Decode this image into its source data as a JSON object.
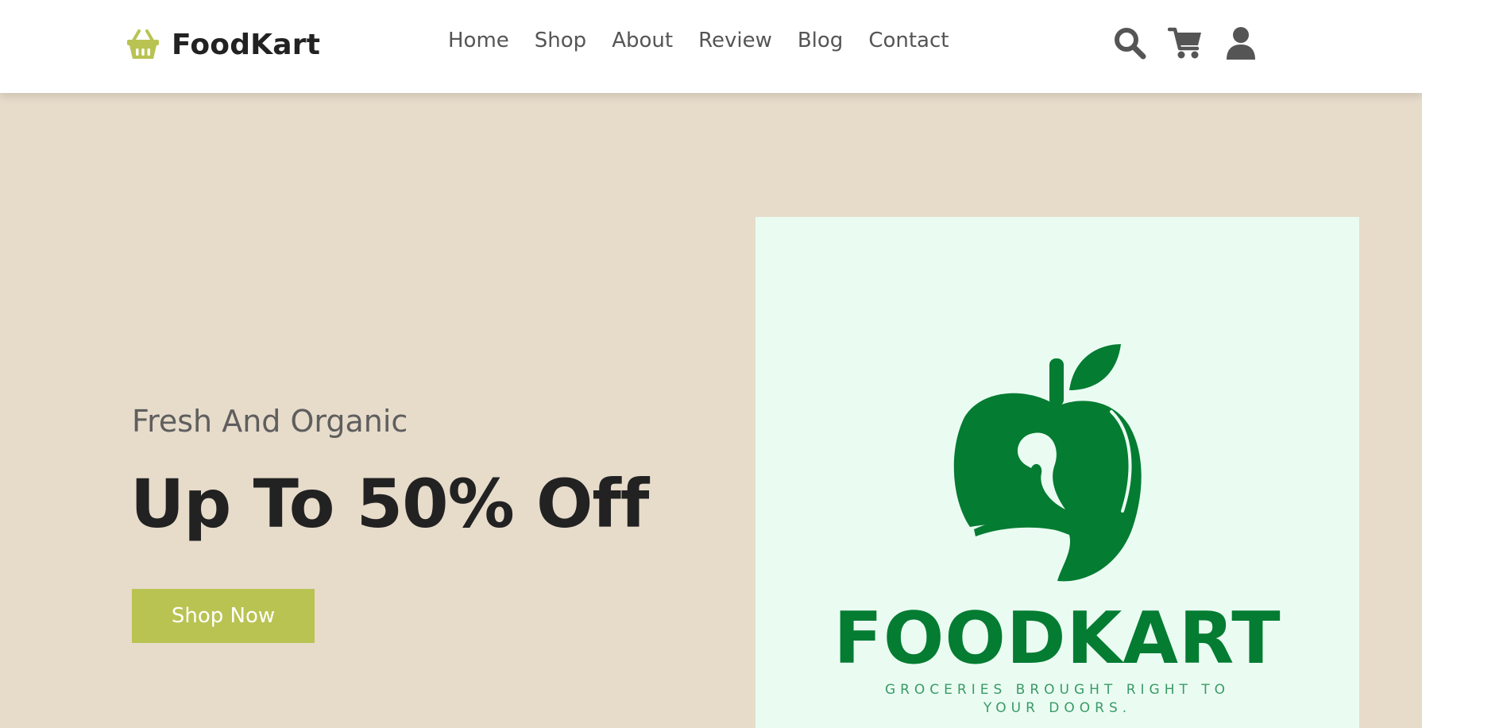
{
  "header": {
    "brand": "FoodKart",
    "brand_icon": "basket-icon",
    "nav": [
      "Home",
      "Shop",
      "About",
      "Review",
      "Blog",
      "Contact"
    ],
    "icons": [
      "search-icon",
      "cart-icon",
      "user-icon"
    ]
  },
  "hero": {
    "subtitle": "Fresh And Organic",
    "title": "Up To 50% Off",
    "cta_label": "Shop Now"
  },
  "promo": {
    "brand_name": "FOODKART",
    "tagline": "GROCERIES BROUGHT RIGHT TO YOUR DOORS."
  },
  "colors": {
    "accent": "#b9c352",
    "hero_bg": "#e7dbca",
    "promo_bg": "#eafcf2",
    "logo_green": "#047c32",
    "text_dark": "#222222",
    "text_muted": "#555555"
  }
}
